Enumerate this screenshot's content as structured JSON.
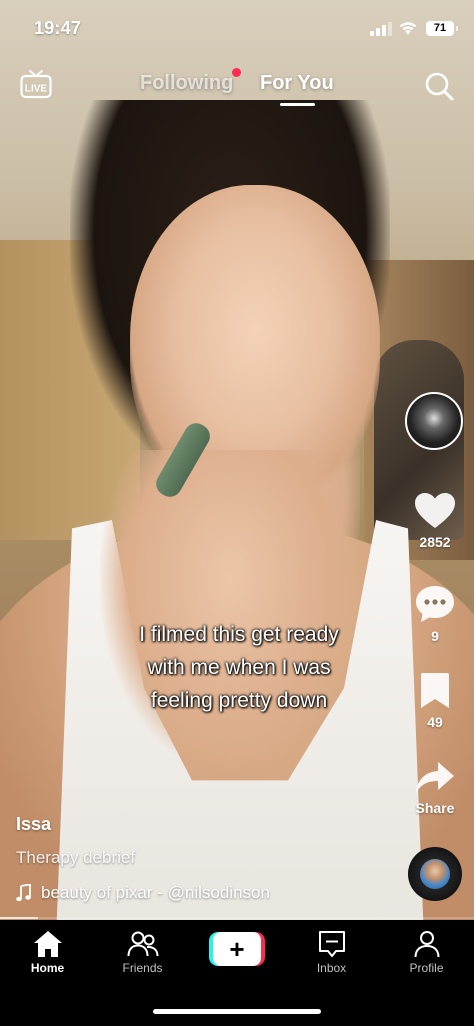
{
  "status_bar": {
    "time": "19:47",
    "battery": "71"
  },
  "top_nav": {
    "live_label": "LIVE",
    "following_label": "Following",
    "foryou_label": "For You"
  },
  "actions": {
    "likes": "2852",
    "comments": "9",
    "saves": "49",
    "share_label": "Share"
  },
  "caption_lines": [
    "I filmed this get ready",
    "with me when I was",
    "feeling pretty down"
  ],
  "post": {
    "username": "Issa",
    "description": "Therapy debrief",
    "sound": "beauty of pixar - @nilsodinson"
  },
  "tab_bar": {
    "home": "Home",
    "friends": "Friends",
    "create": "+",
    "inbox": "Inbox",
    "profile": "Profile"
  },
  "playback_progress": 0.08,
  "colors": {
    "notification_dot": "#fe2c55",
    "create_cyan": "#25f4ee",
    "create_red": "#fe2c55"
  }
}
